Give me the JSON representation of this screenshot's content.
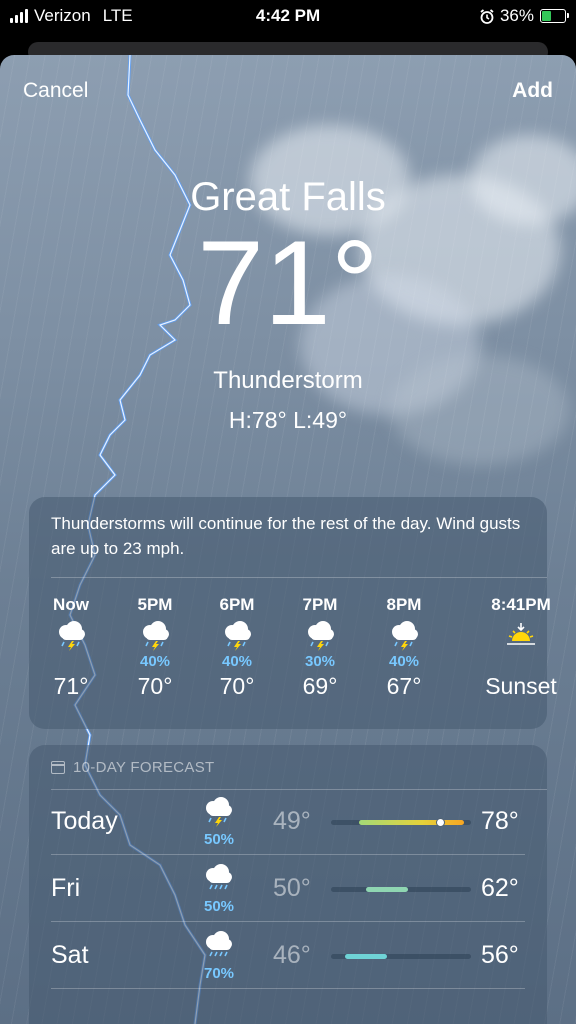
{
  "status_bar": {
    "carrier": "Verizon",
    "network": "LTE",
    "time": "4:42 PM",
    "battery": "36%"
  },
  "header": {
    "cancel_label": "Cancel",
    "add_label": "Add"
  },
  "current": {
    "city": "Great Falls",
    "temperature": "71°",
    "condition": "Thunderstorm",
    "hi_lo": "H:78°  L:49°"
  },
  "hourly": {
    "summary": "Thunderstorms will continue for the rest of the day. Wind gusts are up to 23 mph.",
    "hours": [
      {
        "label": "Now",
        "icon": "thunderstorm-icon",
        "precip": "",
        "temp": "71°"
      },
      {
        "label": "5PM",
        "icon": "thunderstorm-icon",
        "precip": "40%",
        "temp": "70°"
      },
      {
        "label": "6PM",
        "icon": "thunderstorm-icon",
        "precip": "40%",
        "temp": "70°"
      },
      {
        "label": "7PM",
        "icon": "thunderstorm-icon",
        "precip": "30%",
        "temp": "69°"
      },
      {
        "label": "8PM",
        "icon": "thunderstorm-icon",
        "precip": "40%",
        "temp": "67°"
      },
      {
        "label": "8:41PM",
        "icon": "sunset-icon",
        "precip": "",
        "temp": "Sunset"
      }
    ]
  },
  "forecast": {
    "title": "10-DAY FORECAST",
    "days": [
      {
        "day": "Today",
        "icon": "thunderstorm-icon",
        "precip": "50%",
        "low": "49°",
        "high": "78°",
        "range": [
          0.2,
          0.95
        ],
        "current_marker": 0.78
      },
      {
        "day": "Fri",
        "icon": "rain-icon",
        "precip": "50%",
        "low": "50°",
        "high": "62°",
        "range": [
          0.25,
          0.55
        ]
      },
      {
        "day": "Sat",
        "icon": "rain-icon",
        "precip": "70%",
        "low": "46°",
        "high": "56°",
        "range": [
          0.1,
          0.4
        ]
      }
    ]
  },
  "colors": {
    "precip_blue": "#78c8ff",
    "today_bar_start": "#a3d977",
    "today_bar_end": "#f7a623",
    "fri_bar": "#8fd6b2",
    "sat_bar": "#6fd3d6"
  }
}
